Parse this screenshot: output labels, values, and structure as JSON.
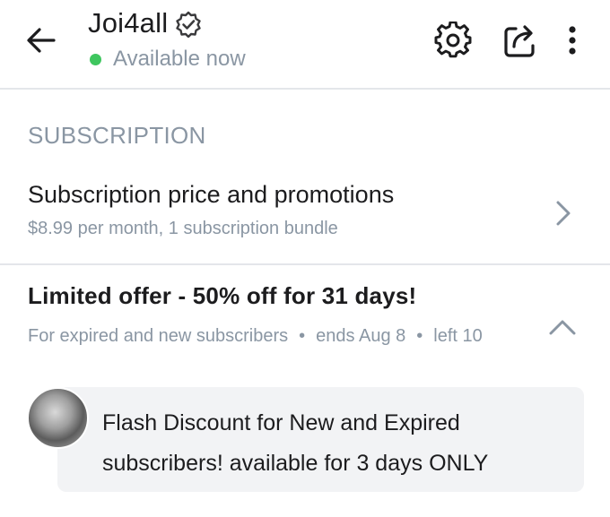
{
  "header": {
    "username": "Joi4all",
    "status": "Available now",
    "status_color": "#3fc65f",
    "icons": [
      "back-arrow-icon",
      "verified-badge-icon",
      "gear-icon",
      "share-icon",
      "more-vertical-icon"
    ]
  },
  "section": {
    "title": "SUBSCRIPTION"
  },
  "subscription": {
    "title": "Subscription price and promotions",
    "detail": "$8.99 per month, 1 subscription bundle"
  },
  "offer": {
    "title": "Limited offer - 50% off for 31 days!",
    "audience": "For expired and new subscribers",
    "separator": "•",
    "ends": "ends Aug 8",
    "left": "left 10",
    "message": "Flash Discount for New and Expired subscribers! available for 3 days ONLY"
  },
  "colors": {
    "muted": "#8a96a3",
    "text": "#1c1c1e",
    "bubble": "#f2f3f5"
  }
}
